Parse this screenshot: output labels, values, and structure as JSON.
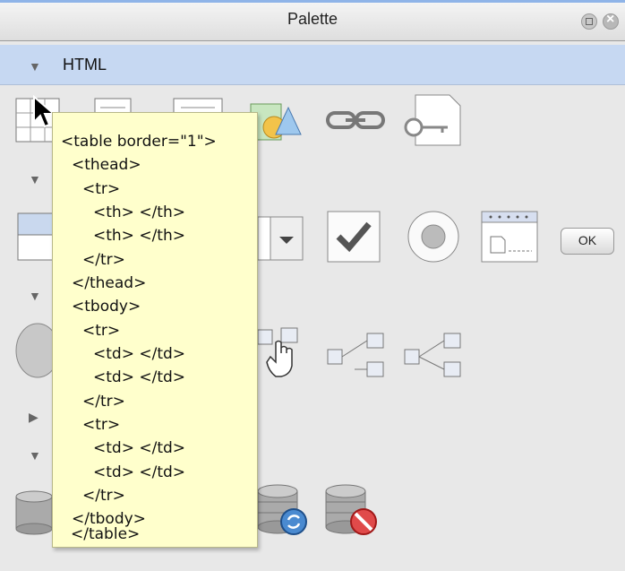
{
  "window": {
    "title": "Palette"
  },
  "category": {
    "label": "HTML"
  },
  "tooltip": {
    "lines": [
      "<table border=\"1\">",
      "<thead>",
      "<tr>",
      "<th> </th>",
      "<th> </th>",
      "</tr>",
      "</thead>",
      "<tbody>",
      "<tr>",
      "<td> </td>",
      "<td> </td>",
      "</tr>",
      "<tr>",
      "<td> </td>",
      "<td> </td>",
      "</tr>",
      "</tbody>",
      "</table>"
    ]
  },
  "buttons": {
    "ok_label": "OK"
  },
  "icons": [
    "table-icon",
    "list-icon",
    "ordered-list-icon",
    "image-icon",
    "link-icon",
    "meta-key-icon",
    "form-icon",
    "text-input-icon",
    "textarea-icon",
    "select-icon",
    "checkbox-icon",
    "radio-icon",
    "file-input-icon",
    "button-icon",
    "capsule-icon",
    "component-icon",
    "hand-cursor-icon",
    "tree-icon",
    "tree-icon-2",
    "database-icon",
    "database-refresh-icon",
    "database-delete-icon"
  ]
}
